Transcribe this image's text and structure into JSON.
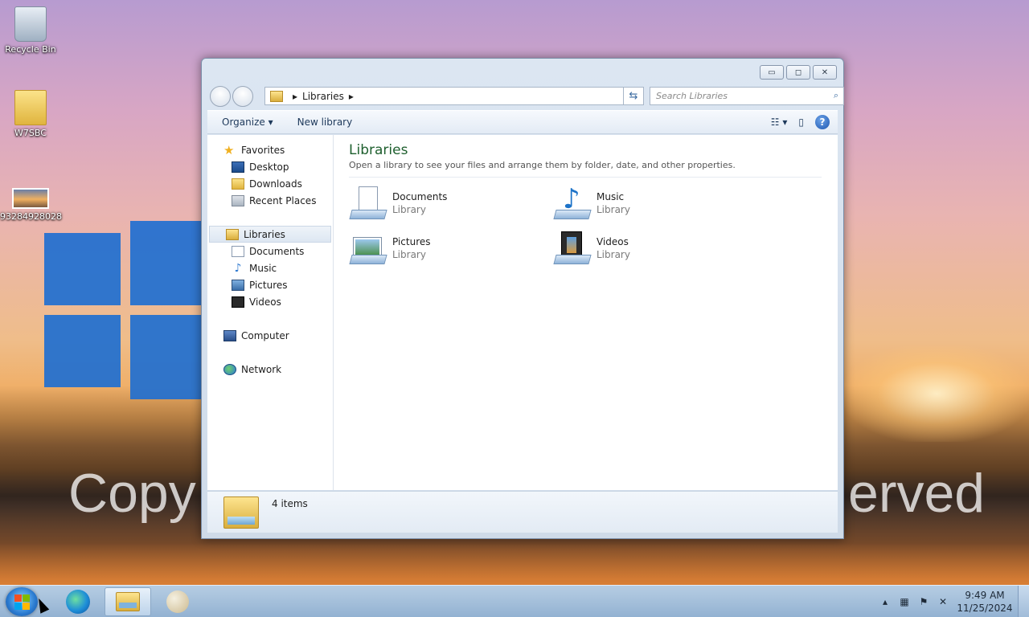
{
  "desktop": {
    "icons": [
      {
        "label": "Recycle Bin",
        "icon": "recycle-bin-icon"
      },
      {
        "label": "W7SBC",
        "icon": "folder-icon"
      },
      {
        "label": "93284928028",
        "icon": "image-file-icon"
      }
    ],
    "watermark_left": "Copy",
    "watermark_right": "erved"
  },
  "window": {
    "caption": {
      "minimize": "▭",
      "maximize": "◻",
      "close": "✕"
    },
    "address": {
      "segment": "Libraries"
    },
    "search": {
      "placeholder": "Search Libraries"
    },
    "toolbar": {
      "organize": "Organize ▾",
      "new_library": "New library"
    },
    "nav": {
      "favorites": "Favorites",
      "desktop": "Desktop",
      "downloads": "Downloads",
      "recent": "Recent Places",
      "libraries": "Libraries",
      "documents": "Documents",
      "music": "Music",
      "pictures": "Pictures",
      "videos": "Videos",
      "computer": "Computer",
      "network": "Network"
    },
    "content": {
      "title": "Libraries",
      "subtitle": "Open a library to see your files and arrange them by folder, date, and other properties.",
      "items": [
        {
          "name": "Documents",
          "type": "Library"
        },
        {
          "name": "Music",
          "type": "Library"
        },
        {
          "name": "Pictures",
          "type": "Library"
        },
        {
          "name": "Videos",
          "type": "Library"
        }
      ]
    },
    "details": {
      "count": "4 items"
    }
  },
  "taskbar": {
    "time": "9:49 AM",
    "date": "11/25/2024"
  },
  "colors": {
    "accent": "#1e5f2e",
    "selection": "#dde7f2",
    "taskbar": "#a8c2dc"
  }
}
